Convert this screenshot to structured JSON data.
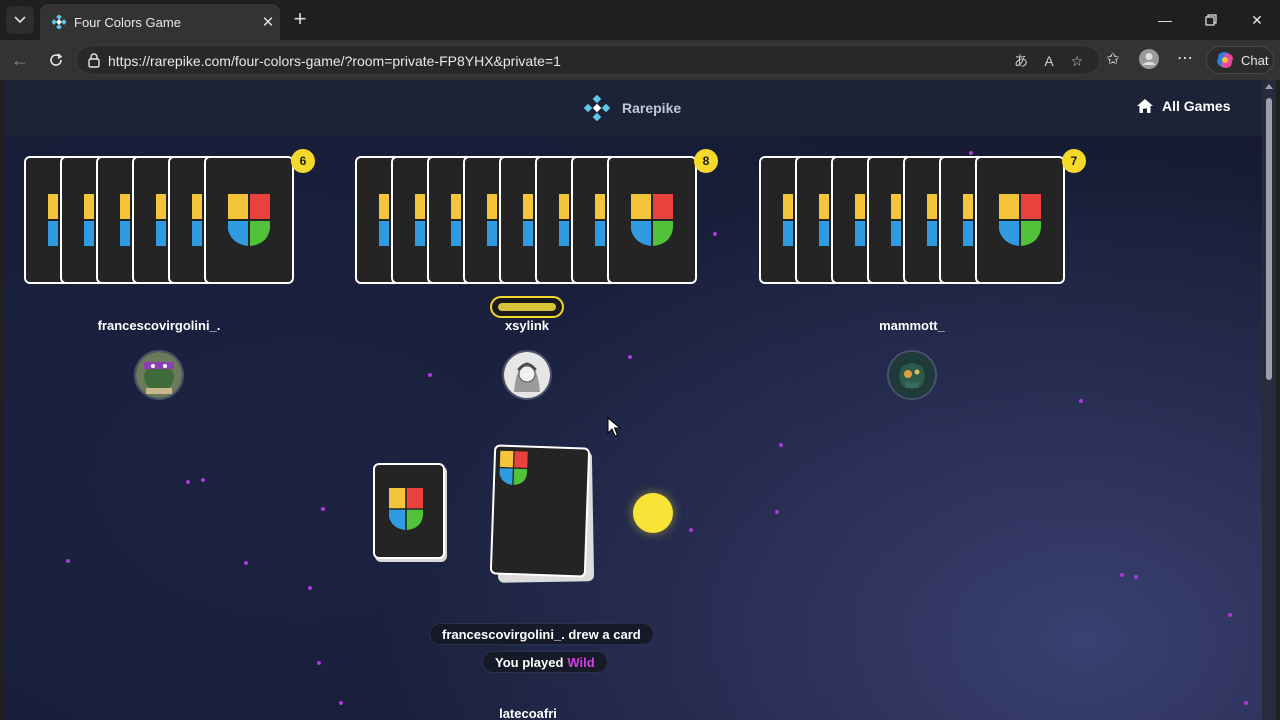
{
  "browser": {
    "tab_title": "Four Colors Game",
    "url": "https://rarepike.com/four-colors-game/?room=private-FP8YHX&private=1",
    "chat_label": "Chat"
  },
  "site": {
    "brand": "Rarepike",
    "all_games": "All Games"
  },
  "players": [
    {
      "name": "francescovirgolini_.",
      "card_count": "6",
      "cards": 6
    },
    {
      "name": "xsylink",
      "card_count": "8",
      "cards": 8,
      "active": true
    },
    {
      "name": "mammott_",
      "card_count": "7",
      "cards": 7
    }
  ],
  "log": {
    "line1": "francescovirgolini_. drew a card",
    "line2_prefix": "You played",
    "line2_card": "Wild"
  },
  "current_color": "#f8e436",
  "bottom_player": "latecoafri",
  "colors": {
    "yellow": "#f4c53a",
    "red": "#e8423c",
    "blue": "#2f9be0",
    "green": "#52c23a",
    "card_bg": "#242424",
    "badge": "#f4d92b"
  }
}
